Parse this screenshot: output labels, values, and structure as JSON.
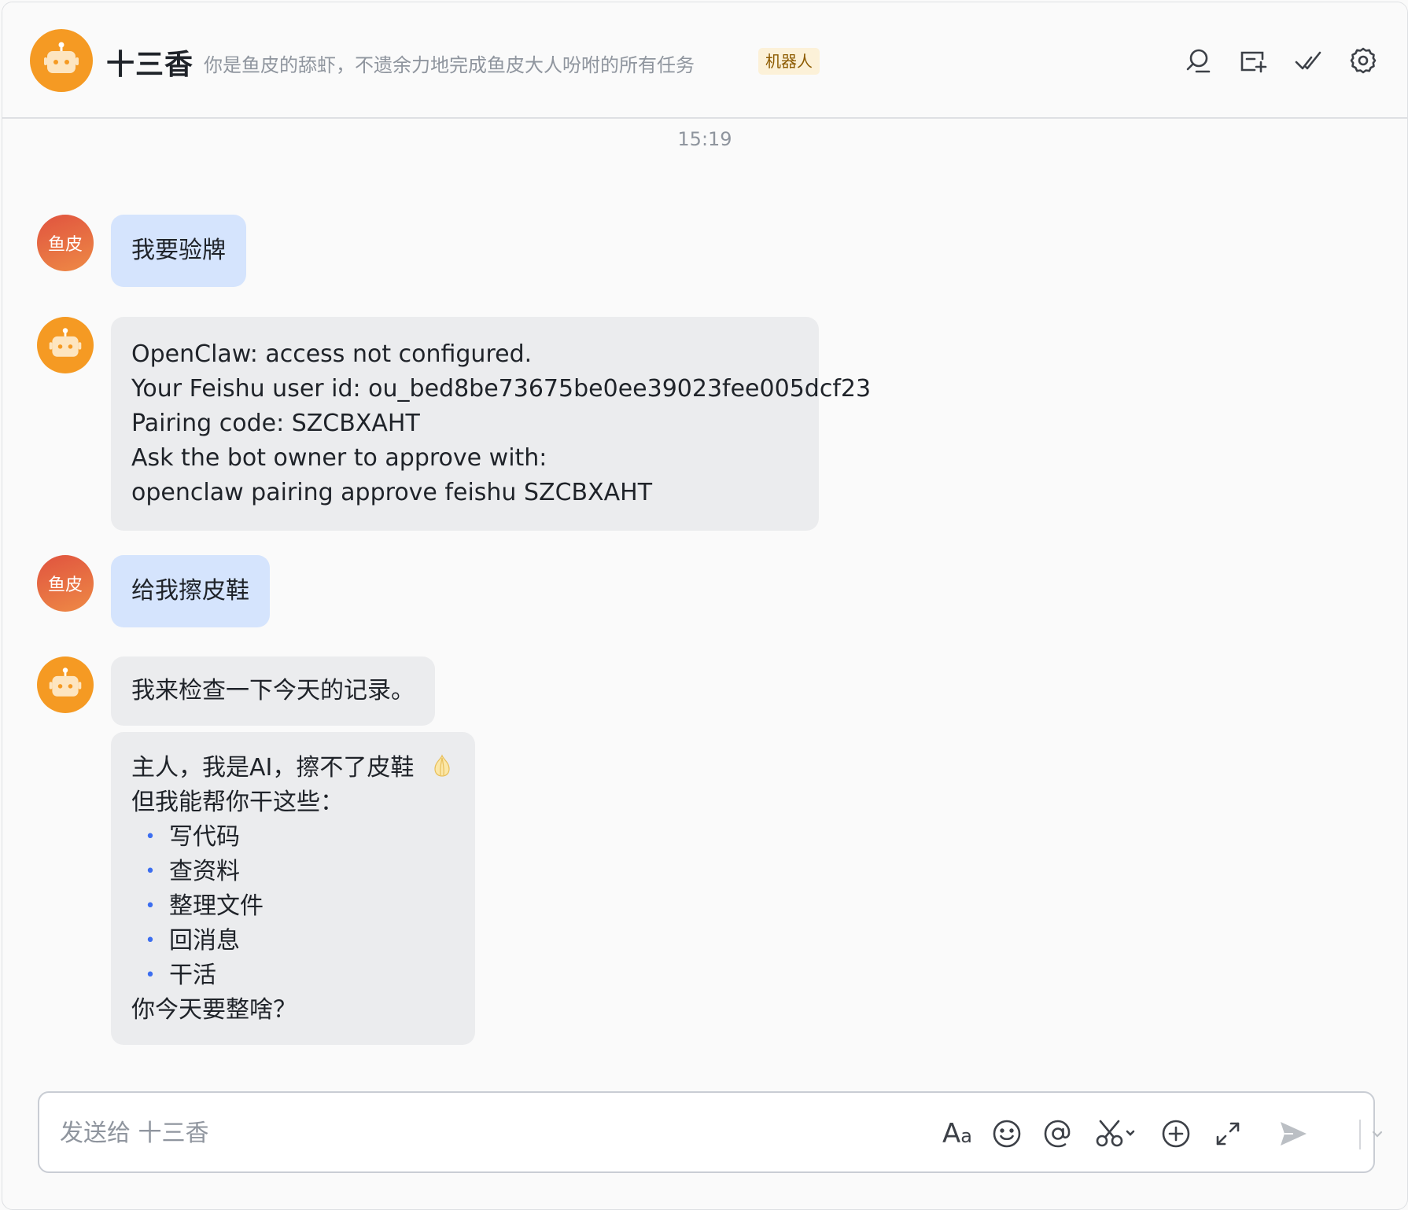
{
  "header": {
    "title": "十三香",
    "description": "你是鱼皮的舔虾，不遗余力地完成鱼皮大人吩咐的所有任务",
    "badge": "机器人",
    "icons": [
      "search-icon",
      "new-topic-icon",
      "done-check-icon",
      "settings-gear-icon"
    ]
  },
  "timestamp": "15:19",
  "user": {
    "avatar_text": "鱼皮"
  },
  "messages": [
    {
      "sender": "user",
      "lines": [
        "我要验牌"
      ]
    },
    {
      "sender": "bot",
      "lines": [
        "OpenClaw: access not configured.",
        "Your Feishu user id: ou_bed8be73675be0ee39023fee005dcf23",
        "Pairing code: SZCBXAHT",
        "Ask the bot owner to approve with:",
        "openclaw pairing approve feishu SZCBXAHT"
      ]
    },
    {
      "sender": "user",
      "lines": [
        "给我擦皮鞋"
      ]
    },
    {
      "sender": "bot",
      "lines": [
        "我来检查一下今天的记录。"
      ]
    },
    {
      "sender": "bot",
      "intro": "主人，我是AI，擦不了皮鞋",
      "intro_emoji": "garlic-emoji",
      "sub": "但我能帮你干这些：",
      "bullets": [
        "写代码",
        "查资料",
        "整理文件",
        "回消息",
        "干活"
      ],
      "outro": "你今天要整啥？"
    }
  ],
  "composer": {
    "placeholder": "发送给 十三香",
    "format_label_big": "A",
    "format_label_small": "a",
    "icons": [
      "text-format-icon",
      "emoji-icon",
      "mention-at-icon",
      "scissors-screenshot-icon",
      "add-plus-icon",
      "expand-icon",
      "send-icon",
      "send-options-chevron-icon"
    ]
  },
  "colors": {
    "user_bubble": "#d5e4fd",
    "bot_bubble": "#ebecee",
    "bot_avatar": "#f59a23",
    "badge_bg": "#fcf1d8",
    "badge_text": "#8d5b00",
    "bullet": "#3c6ef0"
  }
}
